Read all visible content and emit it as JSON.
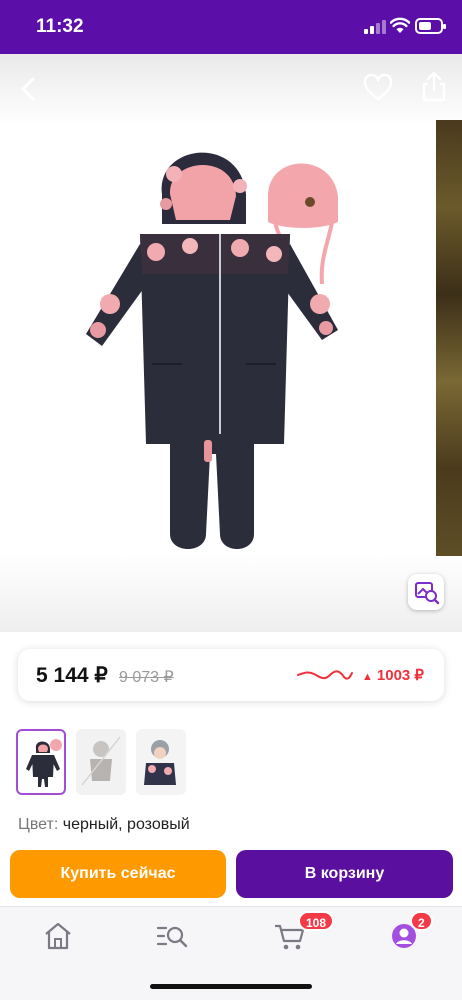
{
  "status_bar": {
    "time": "11:32"
  },
  "product": {
    "price_current": "5 144 ₽",
    "price_old": "9 073 ₽",
    "price_delta": "1003 ₽",
    "color_label": "Цвет:",
    "color_value": "черный, розовый"
  },
  "actions": {
    "buy_now": "Купить сейчас",
    "add_to_cart": "В корзину"
  },
  "tab_bar": {
    "cart_badge": "108",
    "profile_badge": "2"
  },
  "icons": [
    "back-icon",
    "heart-icon",
    "share-icon",
    "visual-search-icon",
    "home-icon",
    "catalog-search-icon",
    "cart-icon",
    "profile-icon"
  ],
  "colors": {
    "brand_purple": "#5b0fa8",
    "buy_orange": "#ff9900",
    "badge_red": "#f43a46",
    "price_red": "#f0303c"
  }
}
